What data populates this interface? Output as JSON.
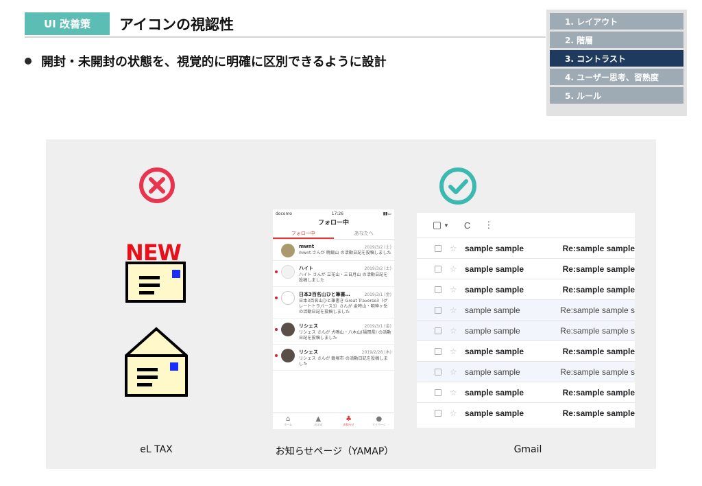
{
  "header": {
    "tag": "UI 改善策",
    "title": "アイコンの視認性",
    "bullet": "開封・未開封の状態を、視覚的に明確に区別できるように設計"
  },
  "nav": {
    "items": [
      {
        "label": "1. レイアウト",
        "active": false
      },
      {
        "label": "2. 階層",
        "active": false
      },
      {
        "label": "3. コントラスト",
        "active": true
      },
      {
        "label": "4. ユーザー思考、習熟度",
        "active": false
      },
      {
        "label": "5. ルール",
        "active": false
      }
    ]
  },
  "colors": {
    "tag": "#5bbdb4",
    "nav_active": "#1e3a5f",
    "nav_inactive": "#9eaab4",
    "bad": "#e8344e",
    "good": "#3bb8b0"
  },
  "eltax": {
    "new_label": "NEW",
    "caption": "eL TAX"
  },
  "yamap": {
    "status_left": "docomo",
    "status_time": "17:26",
    "title": "フォロー中",
    "tabs": [
      "フォロー中",
      "あなたへ"
    ],
    "items": [
      {
        "name": "mwnt",
        "date": "2019/3/2 (土)",
        "text": "mwnt さんが 晩鍛山 の活動日記を投稿しました",
        "unread": false
      },
      {
        "name": "ハイト",
        "date": "2019/3/2 (土)",
        "text": "ハイト さんが 立花山・三日月山 の活動日記を投稿しました",
        "unread": true
      },
      {
        "name": "日本3百名山ひと筆書…",
        "date": "2019/3/1 (金)",
        "text": "日本3百名山ひと筆書き Great Traverse3（グレートトラバース3）さんが 金時山・明神ヶ岳 の活動日記を投稿しました",
        "unread": true
      },
      {
        "name": "リシェス",
        "date": "2019/3/1 (金)",
        "text": "リシェス さんが 犬鳴山・八木山(福岡県) の活動日記を投稿しました",
        "unread": true
      },
      {
        "name": "リシェス",
        "date": "2019/2/28 (木)",
        "text": "リシェス さんが 飯塚市 の活動日記を投稿しました",
        "unread": true
      }
    ],
    "bottom_nav": [
      "ホーム",
      "のぼる",
      "お知らせ",
      "マイページ"
    ],
    "caption": "お知らせページ（YAMAP）"
  },
  "gmail": {
    "toolbar": {
      "refresh": "C",
      "more": "⋮"
    },
    "rows": [
      {
        "from": "sample sample",
        "subject": "Re:sample sample",
        "unread": true
      },
      {
        "from": "sample sample",
        "subject": "Re:sample sample",
        "unread": true
      },
      {
        "from": "sample sample",
        "subject": "Re:sample sample",
        "unread": true
      },
      {
        "from": "sample sample",
        "subject": "Re:sample sample s",
        "unread": false
      },
      {
        "from": "sample sample",
        "subject": "Re:sample sample s",
        "unread": false
      },
      {
        "from": "sample sample",
        "subject": "Re:sample sample",
        "unread": true
      },
      {
        "from": "sample sample",
        "subject": "Re:sample sample s",
        "unread": false
      },
      {
        "from": "sample sample",
        "subject": "Re:sample sample",
        "unread": true
      },
      {
        "from": "sample sample",
        "subject": "Re:sample sample",
        "unread": true
      }
    ],
    "caption": "Gmail"
  }
}
